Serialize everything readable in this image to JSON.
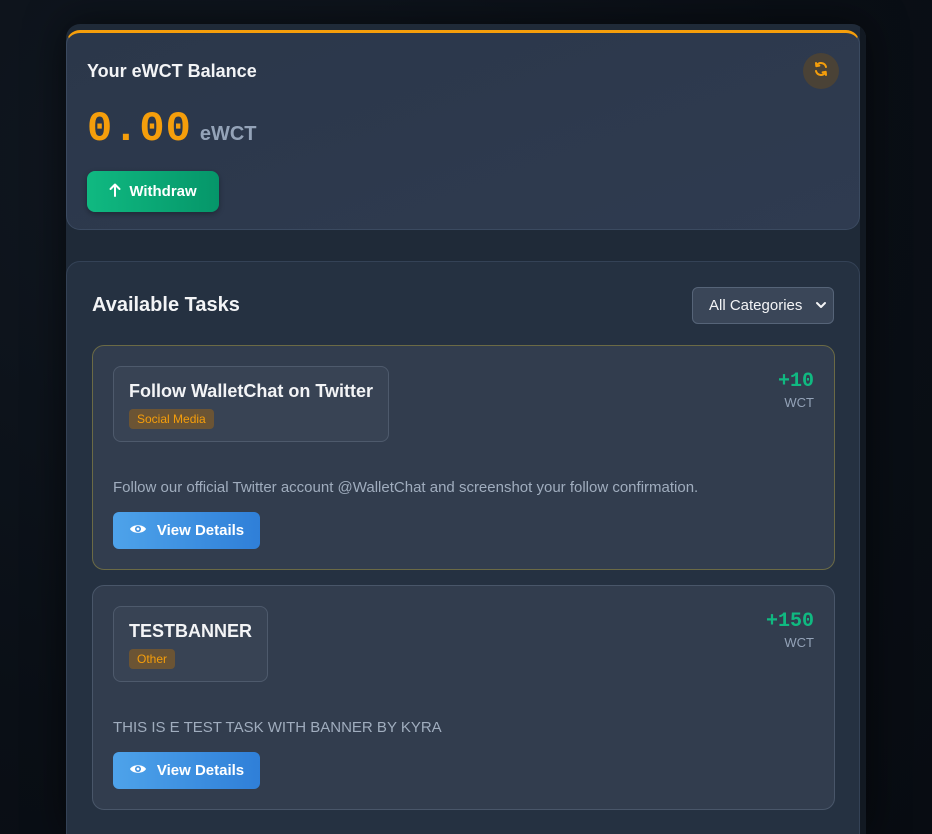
{
  "balance": {
    "title": "Your eWCT Balance",
    "value": "0.00",
    "unit": "eWCT",
    "withdraw_label": "Withdraw",
    "refresh_icon": "refresh-icon",
    "accent_color": "#f59e0b"
  },
  "tasks": {
    "title": "Available Tasks",
    "category_filter": "All Categories",
    "items": [
      {
        "name": "Follow WalletChat on Twitter",
        "tag": "Social Media",
        "reward": "+10",
        "reward_unit": "WCT",
        "description": "Follow our official Twitter account @WalletChat and screenshot your follow confirmation.",
        "button_label": "View Details"
      },
      {
        "name": "TESTBANNER",
        "tag": "Other",
        "reward": "+150",
        "reward_unit": "WCT",
        "description": "THIS IS E TEST TASK WITH BANNER BY KYRA",
        "button_label": "View Details"
      }
    ]
  },
  "colors": {
    "reward": "#10b981",
    "primary_button": "#3b8fe0",
    "withdraw_button": "#10b981"
  }
}
